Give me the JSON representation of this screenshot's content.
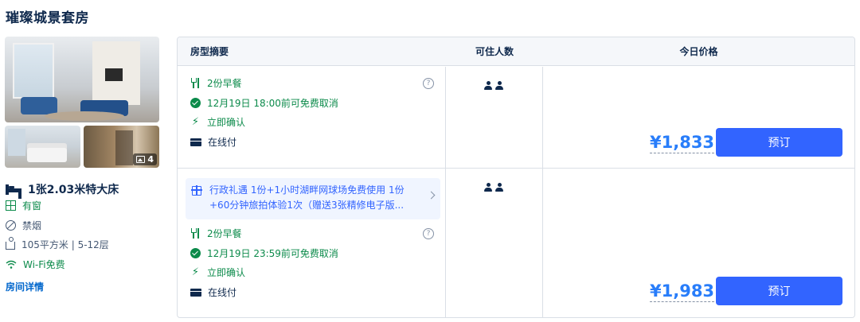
{
  "room": {
    "title": "璀璨城景套房",
    "photo_count": "4",
    "bed": "1张2.03米特大床",
    "features": {
      "window": "有窗",
      "smoking": "禁烟",
      "area": "105平方米 | 5-12层",
      "wifi": "Wi-Fi免费"
    },
    "detail_link": "房间详情"
  },
  "table": {
    "headers": {
      "summary": "房型摘要",
      "occupancy": "可住人数",
      "price": "今日价格"
    },
    "rows": [
      {
        "breakfast": "2份早餐",
        "cancel": "12月19日 18:00前可免费取消",
        "confirm": "立即确认",
        "payment": "在线付",
        "help": "?",
        "price": "¥1,833",
        "book": "预订"
      },
      {
        "perk": "行政礼遇 1份+1小时湖畔网球场免费使用 1份+60分钟旅拍体验1次（赠送3张精修电子版...",
        "breakfast": "2份早餐",
        "cancel": "12月19日 23:59前可免费取消",
        "confirm": "立即确认",
        "payment": "在线付",
        "help": "?",
        "price": "¥1,983",
        "book": "预订"
      }
    ]
  },
  "colors": {
    "accent_blue": "#3264ff",
    "price_blue": "#287dfa",
    "green": "#0b8a4a",
    "text_dark": "#0f294d"
  }
}
